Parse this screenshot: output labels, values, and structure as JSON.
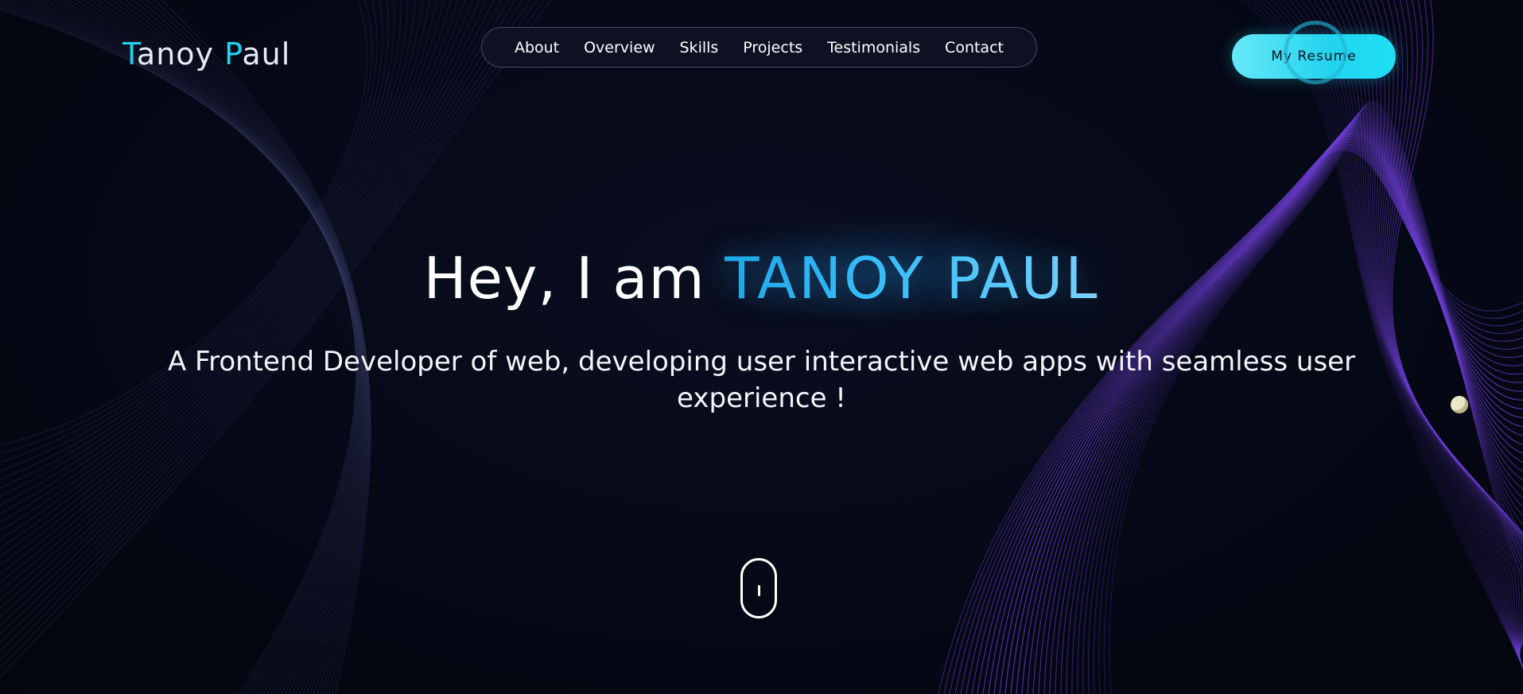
{
  "logo": {
    "first_initial": "T",
    "first_rest": "anoy ",
    "last_initial": "P",
    "last_rest": "aul"
  },
  "nav": {
    "items": [
      {
        "label": "About"
      },
      {
        "label": "Overview"
      },
      {
        "label": "Skills"
      },
      {
        "label": "Projects"
      },
      {
        "label": "Testimonials"
      },
      {
        "label": "Contact"
      }
    ]
  },
  "header": {
    "resume_label": "My Resume"
  },
  "hero": {
    "greeting": "Hey, I am ",
    "name": "TANOY PAUL",
    "subtitle": "A Frontend Developer of web, developing user interactive web apps with seamless user experience !"
  },
  "icons": {
    "scroll": "mouse-scroll-icon"
  },
  "colors": {
    "background": "#050815",
    "accent": "#22d3ee",
    "name_gradient_start": "#1ea7e8",
    "name_gradient_end": "#7dd3fc",
    "wave_lines": "#6d3fd6"
  }
}
